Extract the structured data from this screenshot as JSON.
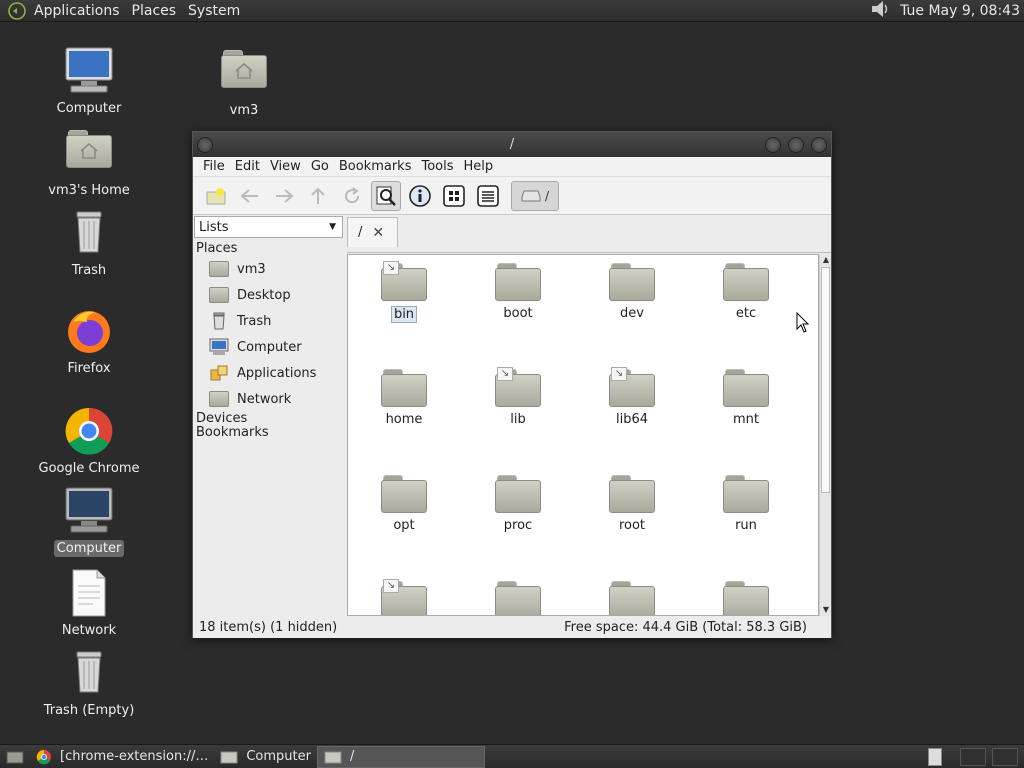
{
  "top_panel": {
    "menus": [
      "Applications",
      "Places",
      "System"
    ],
    "clock": "Tue May  9, 08:43"
  },
  "desktop": {
    "icons": [
      {
        "label": "Computer"
      },
      {
        "label": "vm3's Home"
      },
      {
        "label": "Trash"
      },
      {
        "label": "Firefox"
      },
      {
        "label": "Google Chrome"
      },
      {
        "label": "Computer"
      },
      {
        "label": "Network"
      },
      {
        "label": "Trash (Empty)"
      },
      {
        "label": "vm3"
      }
    ]
  },
  "window": {
    "title": "/",
    "menu": [
      "File",
      "Edit",
      "View",
      "Go",
      "Bookmarks",
      "Tools",
      "Help"
    ],
    "location": "/",
    "side": {
      "combo": "Lists",
      "places_heading": "Places",
      "places": [
        "vm3",
        "Desktop",
        "Trash",
        "Computer",
        "Applications",
        "Network"
      ],
      "devices_heading": "Devices",
      "bookmarks_heading": "Bookmarks"
    },
    "tab": {
      "label": "/",
      "close": "✕"
    },
    "files": [
      "bin",
      "boot",
      "dev",
      "etc",
      "home",
      "lib",
      "lib64",
      "mnt",
      "opt",
      "proc",
      "root",
      "run",
      "",
      "",
      "",
      ""
    ],
    "status": {
      "items": "18 item(s) (1 hidden)",
      "free": "Free space: 44.4 GiB (Total: 58.3 GiB)"
    }
  },
  "taskbar": {
    "items": [
      "[chrome-extension://…",
      "Computer",
      "/"
    ]
  }
}
